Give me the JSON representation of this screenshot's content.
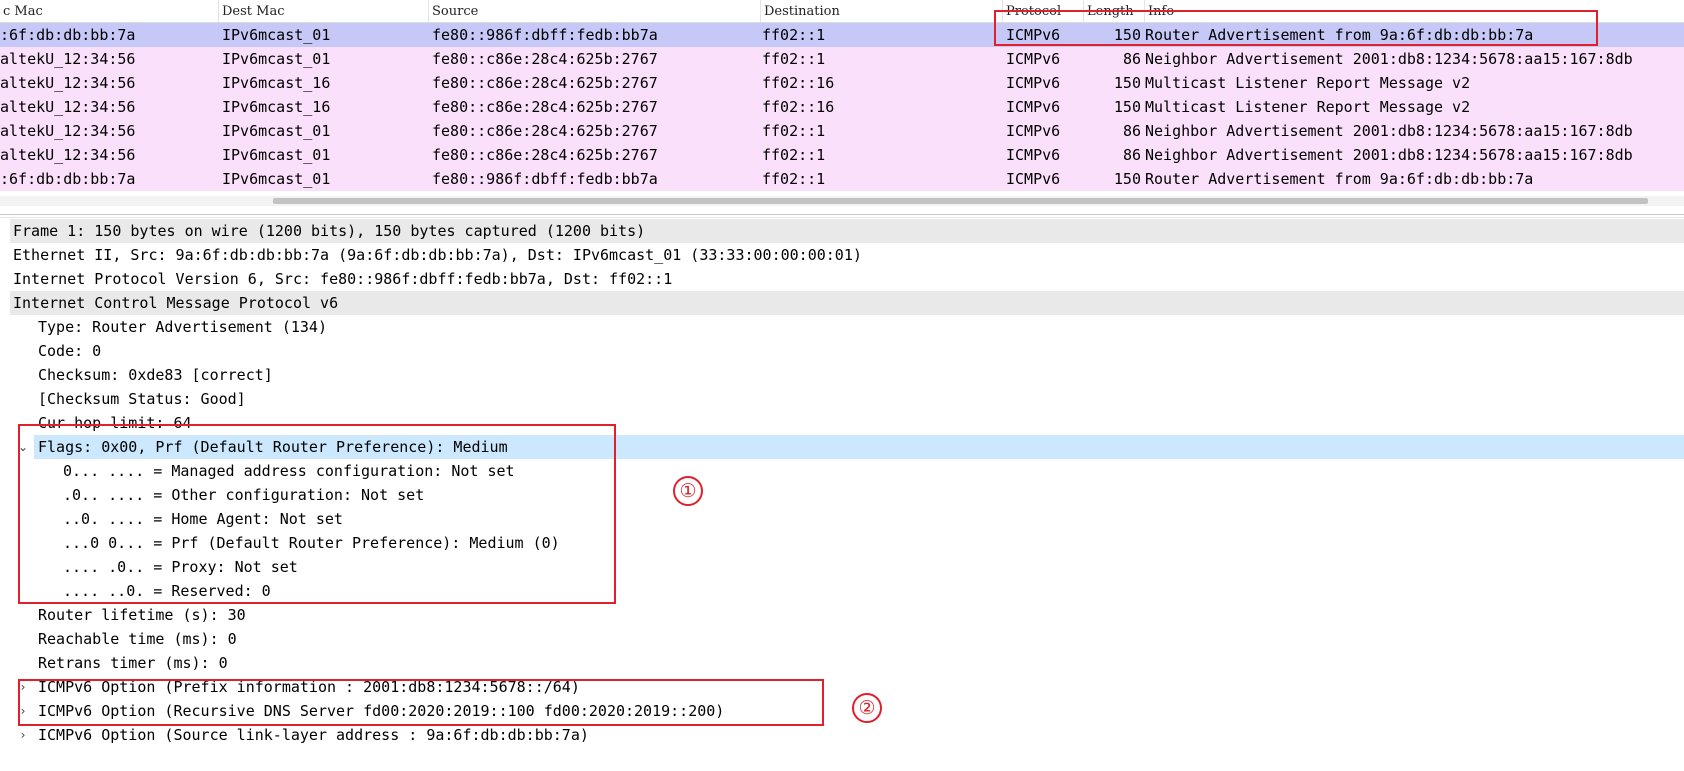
{
  "columns": {
    "src_mac": "c Mac",
    "dest_mac": "Dest Mac",
    "source": "Source",
    "destination": "Destination",
    "protocol": "Protocol",
    "length": "Length",
    "info": "Info"
  },
  "packets": [
    {
      "src_mac": ":6f:db:db:bb:7a",
      "dest_mac": "IPv6mcast_01",
      "source": "fe80::986f:dbff:fedb:bb7a",
      "destination": "ff02::1",
      "protocol": "ICMPv6",
      "length": "150",
      "info": "Router Advertisement from 9a:6f:db:db:bb:7a",
      "selected": true
    },
    {
      "src_mac": "altekU_12:34:56",
      "dest_mac": "IPv6mcast_01",
      "source": "fe80::c86e:28c4:625b:2767",
      "destination": "ff02::1",
      "protocol": "ICMPv6",
      "length": "86",
      "info": "Neighbor Advertisement 2001:db8:1234:5678:aa15:167:8db"
    },
    {
      "src_mac": "altekU_12:34:56",
      "dest_mac": "IPv6mcast_16",
      "source": "fe80::c86e:28c4:625b:2767",
      "destination": "ff02::16",
      "protocol": "ICMPv6",
      "length": "150",
      "info": "Multicast Listener Report Message v2"
    },
    {
      "src_mac": "altekU_12:34:56",
      "dest_mac": "IPv6mcast_16",
      "source": "fe80::c86e:28c4:625b:2767",
      "destination": "ff02::16",
      "protocol": "ICMPv6",
      "length": "150",
      "info": "Multicast Listener Report Message v2"
    },
    {
      "src_mac": "altekU_12:34:56",
      "dest_mac": "IPv6mcast_01",
      "source": "fe80::c86e:28c4:625b:2767",
      "destination": "ff02::1",
      "protocol": "ICMPv6",
      "length": "86",
      "info": "Neighbor Advertisement 2001:db8:1234:5678:aa15:167:8db"
    },
    {
      "src_mac": "altekU_12:34:56",
      "dest_mac": "IPv6mcast_01",
      "source": "fe80::c86e:28c4:625b:2767",
      "destination": "ff02::1",
      "protocol": "ICMPv6",
      "length": "86",
      "info": "Neighbor Advertisement 2001:db8:1234:5678:aa15:167:8db"
    },
    {
      "src_mac": ":6f:db:db:bb:7a",
      "dest_mac": "IPv6mcast_01",
      "source": "fe80::986f:dbff:fedb:bb7a",
      "destination": "ff02::1",
      "protocol": "ICMPv6",
      "length": "150",
      "info": "Router Advertisement from 9a:6f:db:db:bb:7a"
    }
  ],
  "details": [
    {
      "text": "Frame 1: 150 bytes on wire (1200 bits), 150 bytes captured (1200 bits)",
      "level": 0,
      "shaded": true
    },
    {
      "text": "Ethernet II, Src: 9a:6f:db:db:bb:7a (9a:6f:db:db:bb:7a), Dst: IPv6mcast_01 (33:33:00:00:00:01)",
      "level": 0
    },
    {
      "text": "Internet Protocol Version 6, Src: fe80::986f:dbff:fedb:bb7a, Dst: ff02::1",
      "level": 0
    },
    {
      "text": "Internet Control Message Protocol v6",
      "level": 0,
      "shaded": true
    },
    {
      "text": "Type: Router Advertisement (134)",
      "level": 1
    },
    {
      "text": "Code: 0",
      "level": 1
    },
    {
      "text": "Checksum: 0xde83 [correct]",
      "level": 1
    },
    {
      "text": "[Checksum Status: Good]",
      "level": 1
    },
    {
      "text": "Cur hop limit: 64",
      "level": 1
    },
    {
      "text": "Flags: 0x00, Prf (Default Router Preference): Medium",
      "level": 1,
      "selected": true,
      "expanded": true
    },
    {
      "text": "0... .... = Managed address configuration: Not set",
      "level": 2
    },
    {
      "text": ".0.. .... = Other configuration: Not set",
      "level": 2
    },
    {
      "text": "..0. .... = Home Agent: Not set",
      "level": 2
    },
    {
      "text": "...0 0... = Prf (Default Router Preference): Medium (0)",
      "level": 2
    },
    {
      "text": ".... .0.. = Proxy: Not set",
      "level": 2
    },
    {
      "text": ".... ..0. = Reserved: 0",
      "level": 2
    },
    {
      "text": "Router lifetime (s): 30",
      "level": 1
    },
    {
      "text": "Reachable time (ms): 0",
      "level": 1
    },
    {
      "text": "Retrans timer (ms): 0",
      "level": 1
    },
    {
      "text": "ICMPv6 Option (Prefix information : 2001:db8:1234:5678::/64)",
      "level": 1,
      "collapsed": true
    },
    {
      "text": "ICMPv6 Option (Recursive DNS Server fd00:2020:2019::100 fd00:2020:2019::200)",
      "level": 1,
      "collapsed": true
    },
    {
      "text": "ICMPv6 Option (Source link-layer address : 9a:6f:db:db:bb:7a)",
      "level": 1,
      "collapsed": true
    }
  ],
  "annotations": {
    "marker_1": "①",
    "marker_2": "②",
    "color": "#e0202a"
  },
  "colors": {
    "selected_packet_row": "#c6c8f7",
    "icmpv6_row": "#fbe0fb",
    "selected_detail": "#cce8ff",
    "shaded_detail": "#e9e9e9"
  }
}
